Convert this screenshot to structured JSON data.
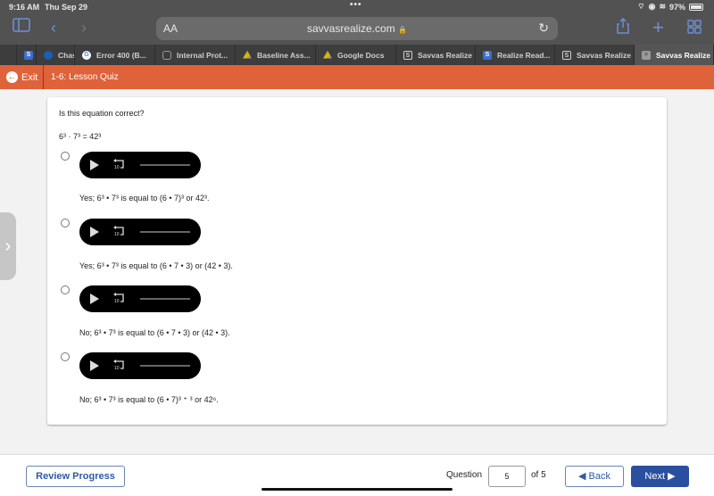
{
  "status_bar": {
    "time": "9:16 AM",
    "date": "Thu Sep 29",
    "dots": "•••",
    "battery": "97%",
    "battery_level": 0.97
  },
  "browser": {
    "text_size_label": "AA",
    "url": "savvasrealize.com",
    "lock_icon": "🔒",
    "tabs": [
      {
        "label": "",
        "icon": "savvas-s-icon",
        "color": "#3b6fd1"
      },
      {
        "label": "Chas",
        "icon": "chase-icon",
        "color": "#1a5fb4"
      },
      {
        "label": "Error 400 (B...",
        "icon": "google-icon",
        "color": "#ffffff"
      },
      {
        "label": "Internal Prot...",
        "icon": "shield-icon",
        "color": "#9a9a9a"
      },
      {
        "label": "Baseline Ass...",
        "icon": "drive-icon",
        "color": "#f4b400"
      },
      {
        "label": "Google Docs",
        "icon": "drive-icon",
        "color": "#f4b400"
      },
      {
        "label": "Savvas Realize",
        "icon": "savvas-s-icon",
        "color": "#cfcfcf"
      },
      {
        "label": "Realize Read...",
        "icon": "savvas-s-icon",
        "color": "#3b6fd1"
      },
      {
        "label": "Savvas Realize",
        "icon": "savvas-s-icon",
        "color": "#cfcfcf"
      },
      {
        "label": "Savvas Realize",
        "icon": "close-icon",
        "color": "#9a9a9a",
        "active": true
      }
    ]
  },
  "header": {
    "exit_label": "Exit",
    "title": "1-6: Lesson Quiz",
    "accent": "#e0623a"
  },
  "question": {
    "prompt": "Is this equation correct?",
    "equation": "6³ · 7³ = 42³",
    "options": [
      {
        "text": "Yes; 6³ • 7³ is equal to (6 • 7)³ or 42³.",
        "selected": false
      },
      {
        "text": "Yes; 6³ • 7³ is equal to (6 • 7 • 3) or (42 • 3).",
        "selected": false
      },
      {
        "text": "No; 6³ • 7³ is equal to (6 • 7 • 3) or (42 • 3).",
        "selected": false
      },
      {
        "text": "No; 6³ • 7³ is equal to (6 • 7)³ ⁺ ³ or 42⁶.",
        "selected": false
      }
    ],
    "audio_rewind_label": "10"
  },
  "footer": {
    "review_label": "Review Progress",
    "question_label": "Question",
    "question_value": "5",
    "of_label": "of 5",
    "back_label": "◀ Back",
    "next_label": "Next ▶",
    "primary_color": "#2a4f9e"
  }
}
